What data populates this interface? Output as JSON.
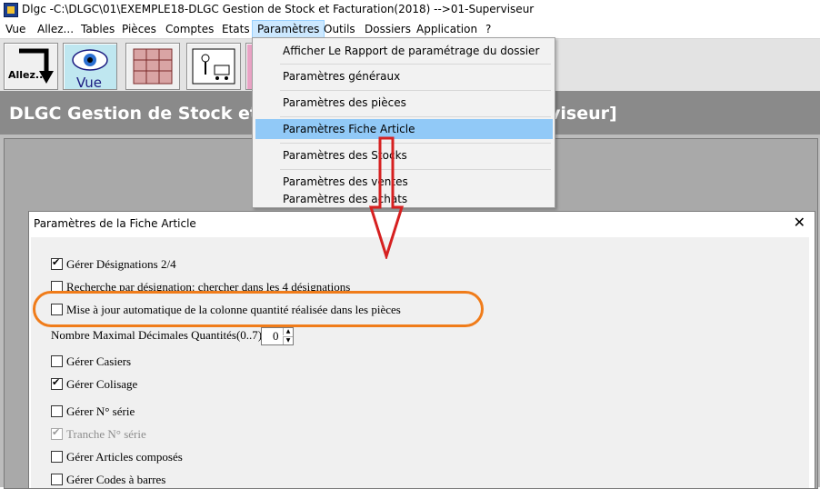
{
  "window": {
    "title": "Dlgc -C:\\DLGC\\01\\EXEMPLE18-DLGC Gestion de Stock et Facturation(2018) -->01-Superviseur"
  },
  "menubar": {
    "items": [
      "Vue",
      "Allez...",
      "Tables",
      "Pièces",
      "Comptes",
      "Etats",
      "Paramètres",
      "Outils",
      "Dossiers",
      "Application",
      "?"
    ]
  },
  "toolbar": {
    "allez_label": "Allez...",
    "vue_label": "Vue"
  },
  "banner": {
    "left": "DLGC Gestion de Stock et F",
    "right": "viseur]"
  },
  "dropdown": {
    "items": [
      "Afficher Le Rapport de paramétrage du dossier",
      "Paramètres généraux",
      "Paramètres des pièces",
      "Paramètres Fiche Article",
      "Paramètres des Stocks",
      "Paramètres des ventes",
      "Paramètres des achats"
    ],
    "highlighted": "Paramètres Fiche Article"
  },
  "dialog": {
    "title": "Paramètres de la Fiche Article",
    "close": "✕",
    "options": [
      {
        "label": "Gérer Désignations 2/4",
        "checked": true,
        "disabled": false
      },
      {
        "label": "Recherche par désignation: chercher dans les 4 désignations",
        "checked": false,
        "disabled": false
      },
      {
        "label": "Mise à jour automatique de la colonne quantité réalisée dans les pièces",
        "checked": false,
        "disabled": false
      },
      {
        "label": "Gérer Casiers",
        "checked": false,
        "disabled": false
      },
      {
        "label": "Gérer Colisage",
        "checked": true,
        "disabled": false
      },
      {
        "label": "Gérer N° série",
        "checked": false,
        "disabled": false
      },
      {
        "label": "Tranche N° série",
        "checked": true,
        "disabled": true
      },
      {
        "label": "Gérer Articles composés",
        "checked": false,
        "disabled": false
      },
      {
        "label": "Gérer Codes à barres",
        "checked": false,
        "disabled": false
      }
    ],
    "decimals_label": "Nombre Maximal Décimales Quantités(0..7):",
    "decimals_value": "0"
  },
  "colors": {
    "highlight_orange": "#f07c1a",
    "arrow_red": "#d62020",
    "menu_highlight": "#91c9f7"
  }
}
